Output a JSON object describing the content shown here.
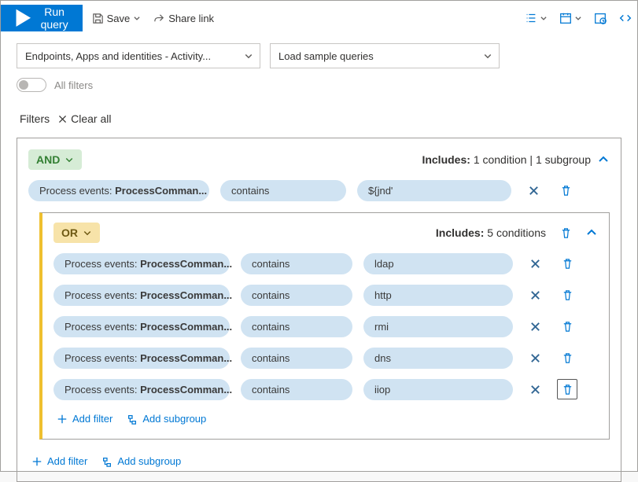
{
  "toolbar": {
    "run": "Run query",
    "save": "Save",
    "share": "Share link"
  },
  "selectors": {
    "scope": "Endpoints, Apps and identities - Activity...",
    "sample": "Load sample queries"
  },
  "allFilters": {
    "label": "All filters"
  },
  "filters": {
    "label": "Filters",
    "clear": "Clear all"
  },
  "outer": {
    "op": "AND",
    "includes_label": "Includes:",
    "includes_text": "1 condition | 1 subgroup",
    "row": {
      "field_prefix": "Process events: ",
      "field_bold": "ProcessComman...",
      "op": "contains",
      "val": "${jnd'"
    }
  },
  "inner": {
    "op": "OR",
    "includes_label": "Includes:",
    "includes_text": "5 conditions",
    "rows": [
      {
        "field_prefix": "Process events: ",
        "field_bold": "ProcessComman...",
        "op": "contains",
        "val": "ldap"
      },
      {
        "field_prefix": "Process events: ",
        "field_bold": "ProcessComman...",
        "op": "contains",
        "val": "http"
      },
      {
        "field_prefix": "Process events: ",
        "field_bold": "ProcessComman...",
        "op": "contains",
        "val": "rmi"
      },
      {
        "field_prefix": "Process events: ",
        "field_bold": "ProcessComman...",
        "op": "contains",
        "val": "dns"
      },
      {
        "field_prefix": "Process events: ",
        "field_bold": "ProcessComman...",
        "op": "contains",
        "val": "iiop"
      }
    ]
  },
  "actions": {
    "addFilter": "Add filter",
    "addSubgroup": "Add subgroup"
  }
}
